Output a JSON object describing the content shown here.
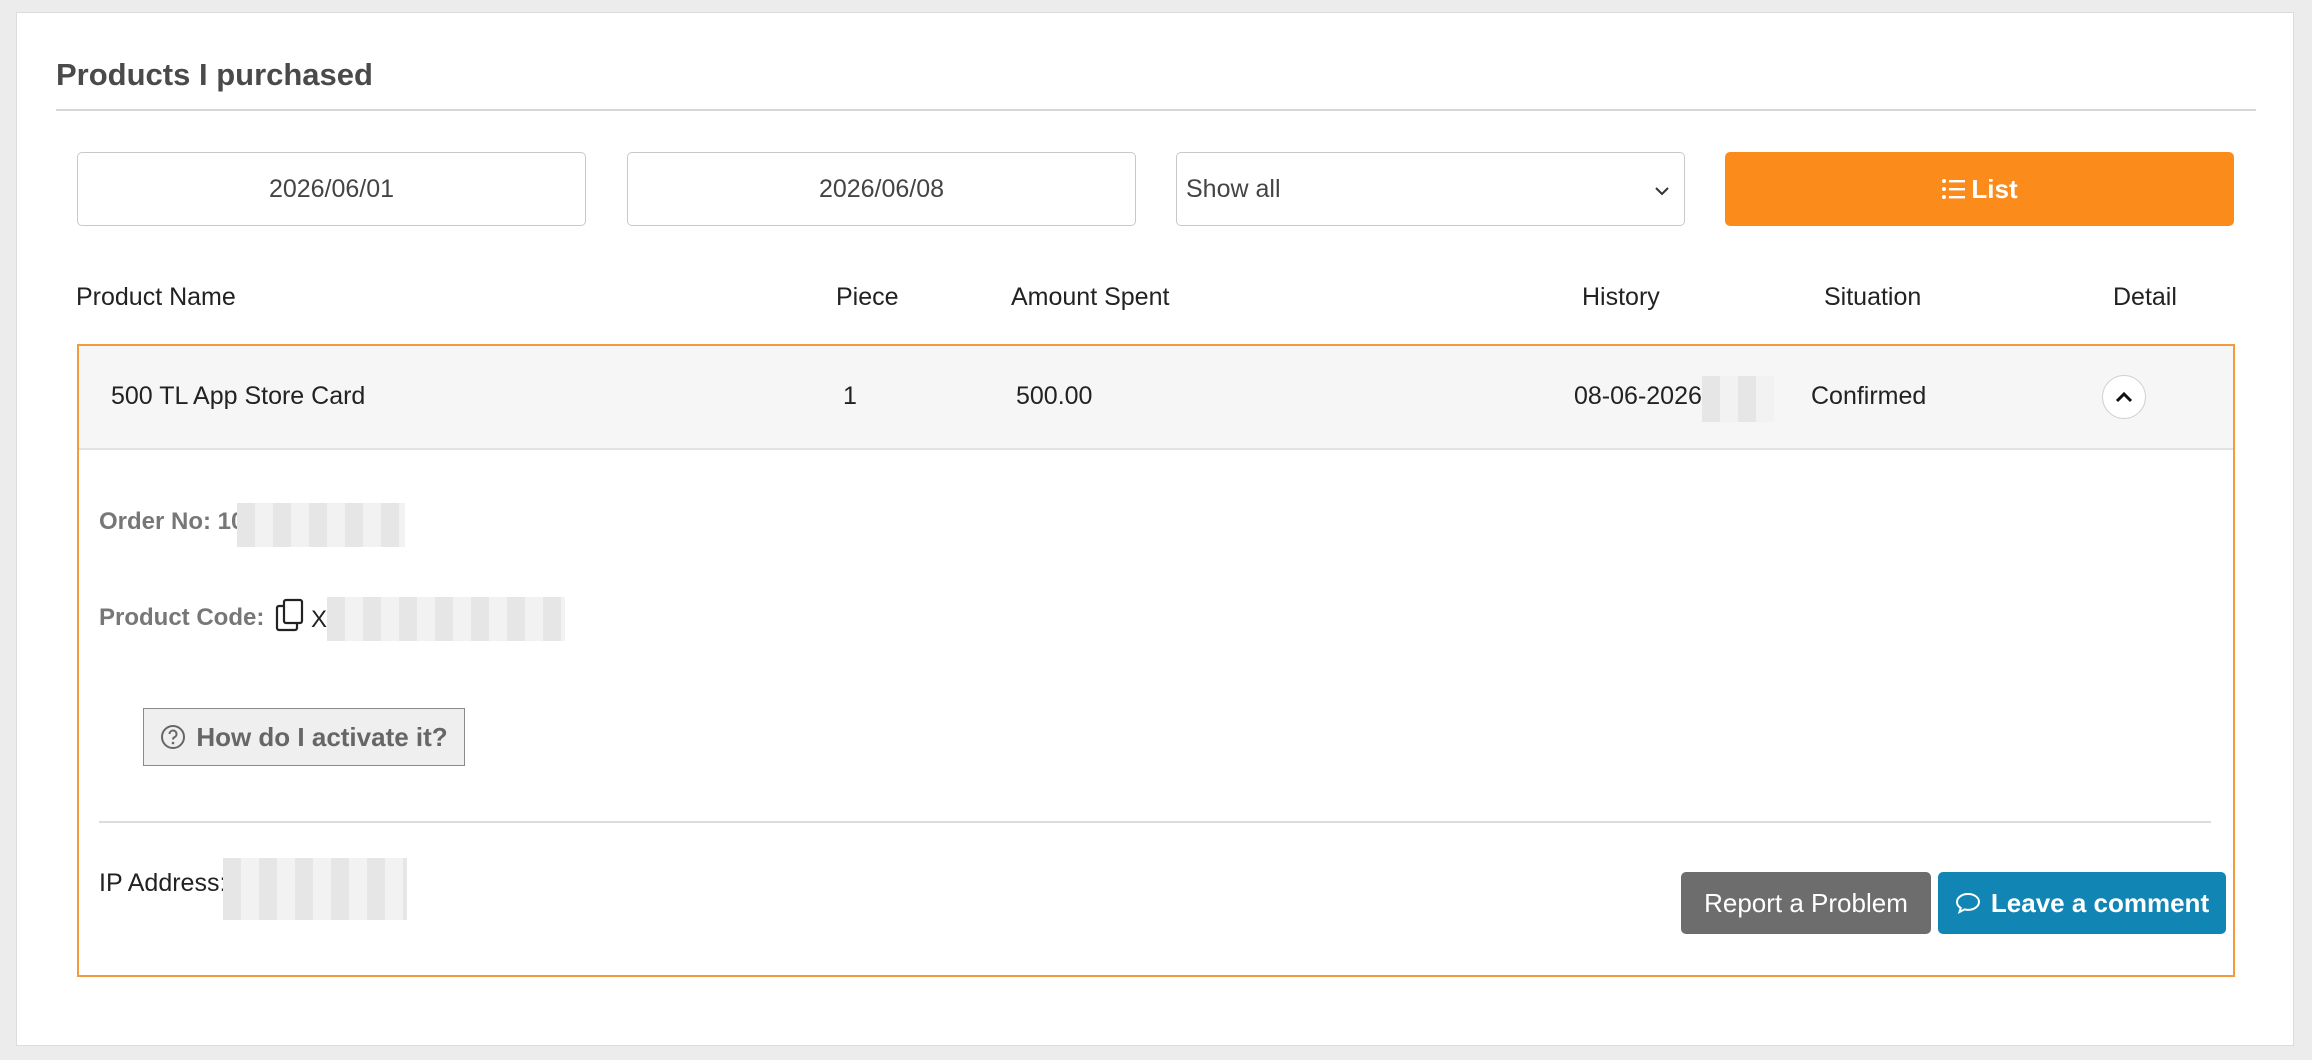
{
  "section": {
    "title": "Products I purchased"
  },
  "filters": {
    "start_date": "2026/06/01",
    "end_date": "2026/06/08",
    "status_select": "Show all",
    "list_button": "List"
  },
  "table": {
    "headers": {
      "product_name": "Product Name",
      "piece": "Piece",
      "amount_spent": "Amount Spent",
      "history": "History",
      "situation": "Situation",
      "detail": "Detail"
    },
    "rows": [
      {
        "product_name": "500 TL App Store Card",
        "piece": "1",
        "amount_spent": "500.00",
        "history": "08-06-2026",
        "situation": "Confirmed"
      }
    ]
  },
  "detail": {
    "order_label": "Order No: 10",
    "product_code_label": "Product Code:",
    "product_code_prefix": "X",
    "howto_button": "How do I activate it?",
    "ip_label": "IP Address:",
    "report_button": "Report a Problem",
    "comment_button": "Leave a comment"
  },
  "colors": {
    "accent_orange": "#fb8c1c",
    "row_border": "#f39a3c",
    "report_gray": "#6d6d6d",
    "comment_blue": "#1185b3"
  },
  "icons": {
    "list_button": "list-icon",
    "detail_toggle": "chevron-up-icon",
    "copy": "copy-icon",
    "howto": "question-circle-icon",
    "comment": "speech-bubble-icon",
    "select": "chevron-down-icon"
  }
}
